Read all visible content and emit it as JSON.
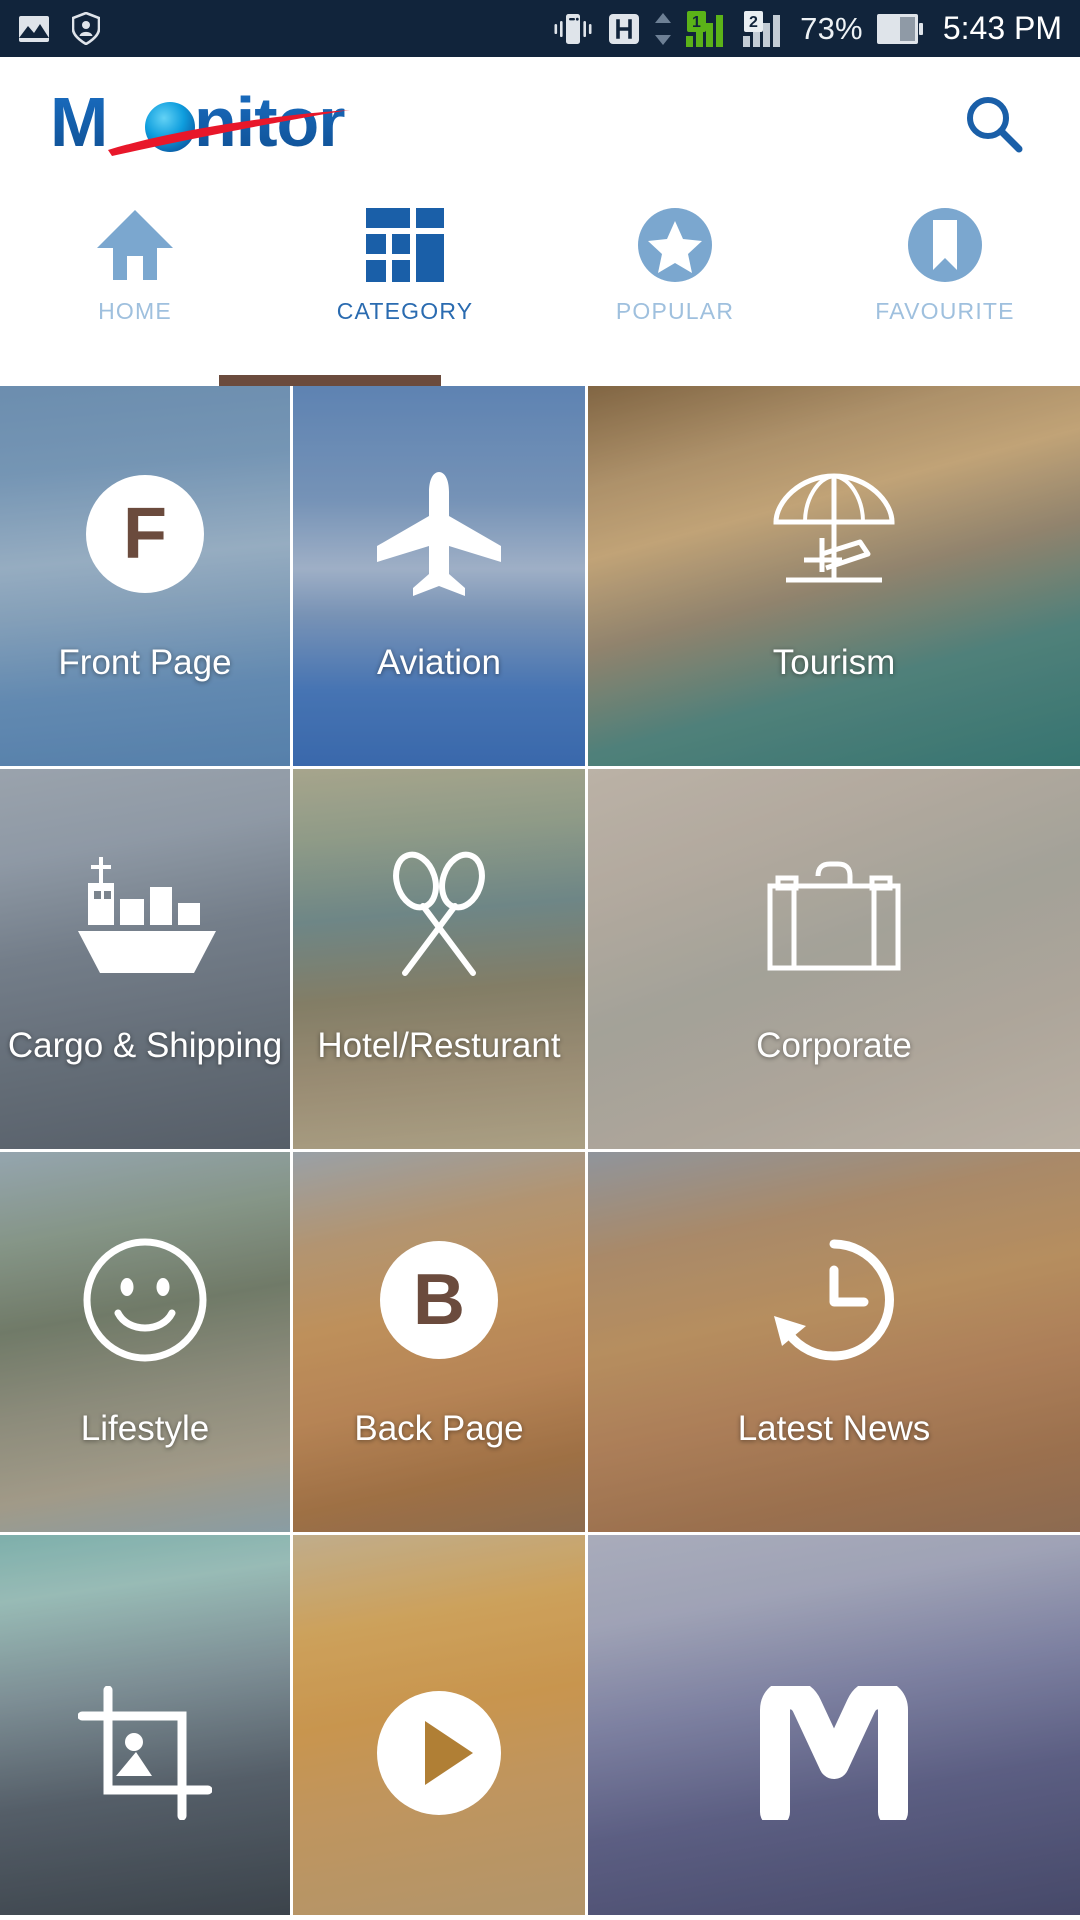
{
  "status_bar": {
    "background_color": "#11243b",
    "left_icons": [
      {
        "name": "gallery-image-icon",
        "label": "Gallery"
      },
      {
        "name": "shield-person-icon",
        "label": "Security"
      }
    ],
    "right_icons": [
      {
        "name": "vibrate-icon",
        "label": "Vibrate mode"
      },
      {
        "name": "hspa-network-icon",
        "label": "H"
      },
      {
        "name": "data-transfer-arrows-icon",
        "label": "Data up/down"
      },
      {
        "name": "sim1-signal-icon",
        "label": "1",
        "color": "#5bb318"
      },
      {
        "name": "sim2-signal-icon",
        "label": "2",
        "color": "#dfe4ea"
      },
      {
        "name": "battery-icon",
        "label": "Battery"
      }
    ],
    "battery_percent": "73%",
    "clock": "5:43 PM"
  },
  "header": {
    "brand_name": "Monitor",
    "brand_colors": {
      "text": "#1560ad",
      "globe": "#0d9ddb",
      "swoosh": "#e8172a"
    },
    "search_icon": "search-icon",
    "search_color": "#1a5fa8"
  },
  "tabs": {
    "active_index": 1,
    "indicator_color": "#6b4b3d",
    "items": [
      {
        "label": "HOME",
        "icon": "home-icon",
        "active": false
      },
      {
        "label": "CATEGORY",
        "icon": "grid-category-icon",
        "active": true
      },
      {
        "label": "POPULAR",
        "icon": "star-circle-icon",
        "active": false
      },
      {
        "label": "FAVOURITE",
        "icon": "bookmark-circle-icon",
        "active": false
      }
    ],
    "inactive_color": "#9fc0de",
    "active_color": "#2a6bb0",
    "icon_inactive_color": "#7ba7cf",
    "icon_active_color": "#1a5fa8"
  },
  "grid": {
    "columns": 3,
    "tiles": [
      {
        "label": "Front Page",
        "icon": "letter-f-circle-icon",
        "badge_letter": "F",
        "bg": "airplane-sky",
        "veil": "rgba(70,110,150,0.34)"
      },
      {
        "label": "Aviation",
        "icon": "airplane-icon",
        "badge_letter": "",
        "bg": "airplane-takeoff",
        "veil": "rgba(45,85,145,0.30)"
      },
      {
        "label": "Tourism",
        "icon": "beach-umbrella-icon",
        "badge_letter": "",
        "bg": "resort-umbrella",
        "veil": "rgba(90,80,60,0.22)"
      },
      {
        "label": "Cargo & Shipping",
        "icon": "cargo-ship-icon",
        "badge_letter": "",
        "bg": "port-containers",
        "veil": "rgba(120,128,138,0.40)"
      },
      {
        "label": "Hotel/Resturant",
        "icon": "crossed-spoons-icon",
        "badge_letter": "",
        "bg": "hotel-interior",
        "veil": "rgba(110,115,95,0.30)"
      },
      {
        "label": "Corporate",
        "icon": "briefcase-icon",
        "badge_letter": "",
        "bg": "office-people",
        "veil": "rgba(150,140,130,0.38)"
      },
      {
        "label": "Lifestyle",
        "icon": "smiley-face-icon",
        "badge_letter": "",
        "bg": "garden-pool",
        "veil": "rgba(120,125,120,0.32)"
      },
      {
        "label": "Back Page",
        "icon": "letter-b-circle-icon",
        "badge_letter": "B",
        "bg": "market-street",
        "veil": "rgba(140,110,90,0.30)"
      },
      {
        "label": "Latest News",
        "icon": "clock-refresh-icon",
        "badge_letter": "",
        "bg": "street-evening",
        "veil": "rgba(135,110,85,0.32)"
      },
      {
        "label": "",
        "icon": "photo-crop-icon",
        "badge_letter": "",
        "bg": "conference-group",
        "veil": "rgba(120,140,145,0.26)"
      },
      {
        "label": "",
        "icon": "play-circle-icon",
        "badge_letter": "",
        "bg": "food-dish",
        "veil": "rgba(160,130,80,0.26)"
      },
      {
        "label": "",
        "icon": "letter-m-icon",
        "badge_letter": "",
        "bg": "newspaper-blue",
        "veil": "rgba(120,125,150,0.28)"
      }
    ]
  }
}
